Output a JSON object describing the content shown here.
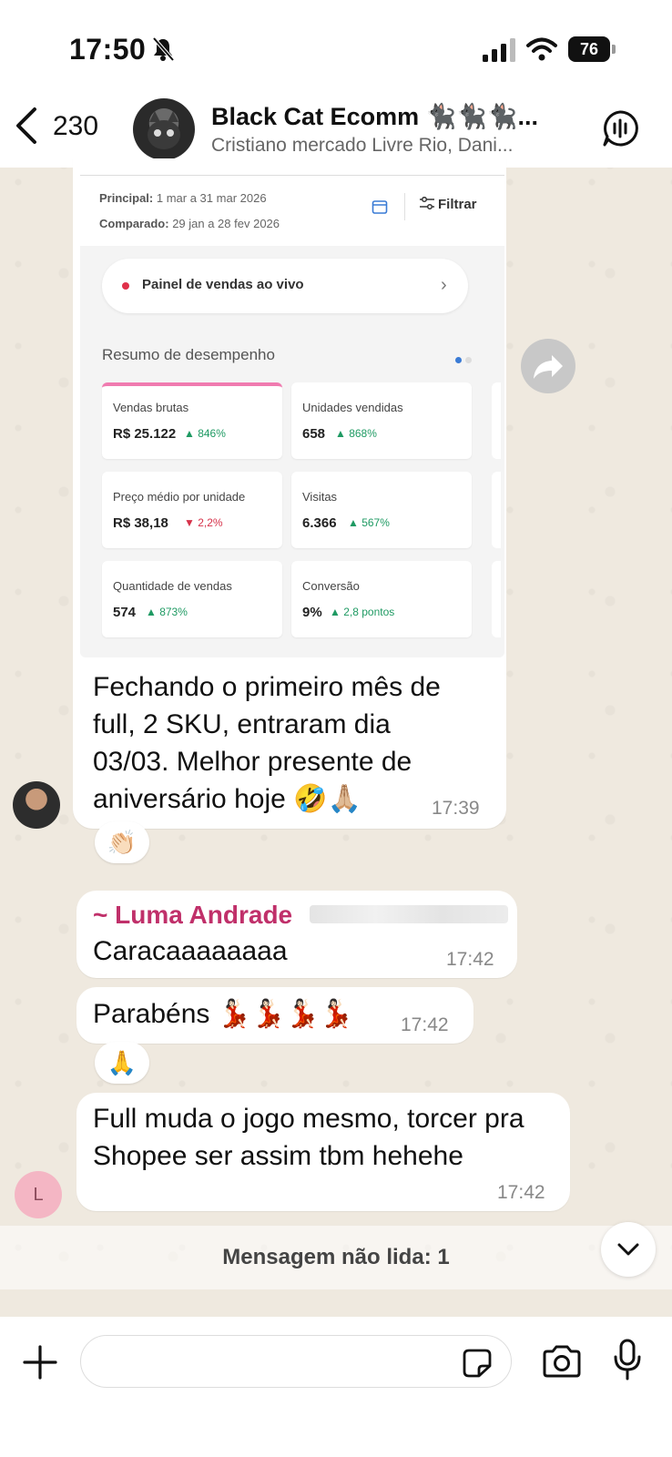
{
  "status_bar": {
    "time": "17:50",
    "battery": "76"
  },
  "header": {
    "back_count": "230",
    "title": "Black Cat Ecomm 🐈‍⬛🐈‍⬛🐈‍⬛...",
    "subtitle": "Cristiano mercado Livre Rio, Dani..."
  },
  "shared_screenshot": {
    "principal_label": "Principal:",
    "principal_value": "1 mar a 31 mar 2026",
    "comparado_label": "Comparado:",
    "comparado_value": "29 jan a 28 fev 2026",
    "filter_label": "Filtrar",
    "live_panel_label": "Painel de vendas ao vivo",
    "summary_title": "Resumo de desempenho",
    "cards": [
      {
        "label": "Vendas brutas",
        "value": "R$ 25.122",
        "delta": "▲ 846%",
        "trend": "up"
      },
      {
        "label": "Unidades vendidas",
        "value": "658",
        "delta": "▲ 868%",
        "trend": "up"
      },
      {
        "label": "Preço médio por unidade",
        "value": "R$ 38,18",
        "delta": "▼ 2,2%",
        "trend": "down"
      },
      {
        "label": "Visitas",
        "value": "6.366",
        "delta": "▲ 567%",
        "trend": "up"
      },
      {
        "label": "Quantidade de vendas",
        "value": "574",
        "delta": "▲ 873%",
        "trend": "up"
      },
      {
        "label": "Conversão",
        "value": "9%",
        "delta": "▲ 2,8 pontos",
        "trend": "up"
      }
    ]
  },
  "messages": [
    {
      "line1": "Fechando o primeiro mês de",
      "line2": "full, 2 SKU, entraram dia",
      "line3": "03/03. Melhor presente de",
      "line4": "aniversário hoje 🤣🙏🏼",
      "time": "17:39",
      "reaction": "👏🏻"
    },
    {
      "sender": "~ Luma Andrade",
      "text": "Caracaaaaaaaa",
      "time": "17:42"
    },
    {
      "text": "Parabéns 💃🏻💃🏻💃🏻💃🏻",
      "time": "17:42",
      "reaction": "🙏"
    },
    {
      "line1": "Full muda o jogo mesmo, torcer pra",
      "line2": "Shopee ser assim tbm hehehe",
      "time": "17:42",
      "avatar_letter": "L"
    }
  ],
  "unread_banner": "Mensagem não lida: 1",
  "colors": {
    "sender_name": "#c0306a",
    "positive": "#1f9a63",
    "negative": "#d6324a",
    "live_dot": "#e0304a"
  }
}
